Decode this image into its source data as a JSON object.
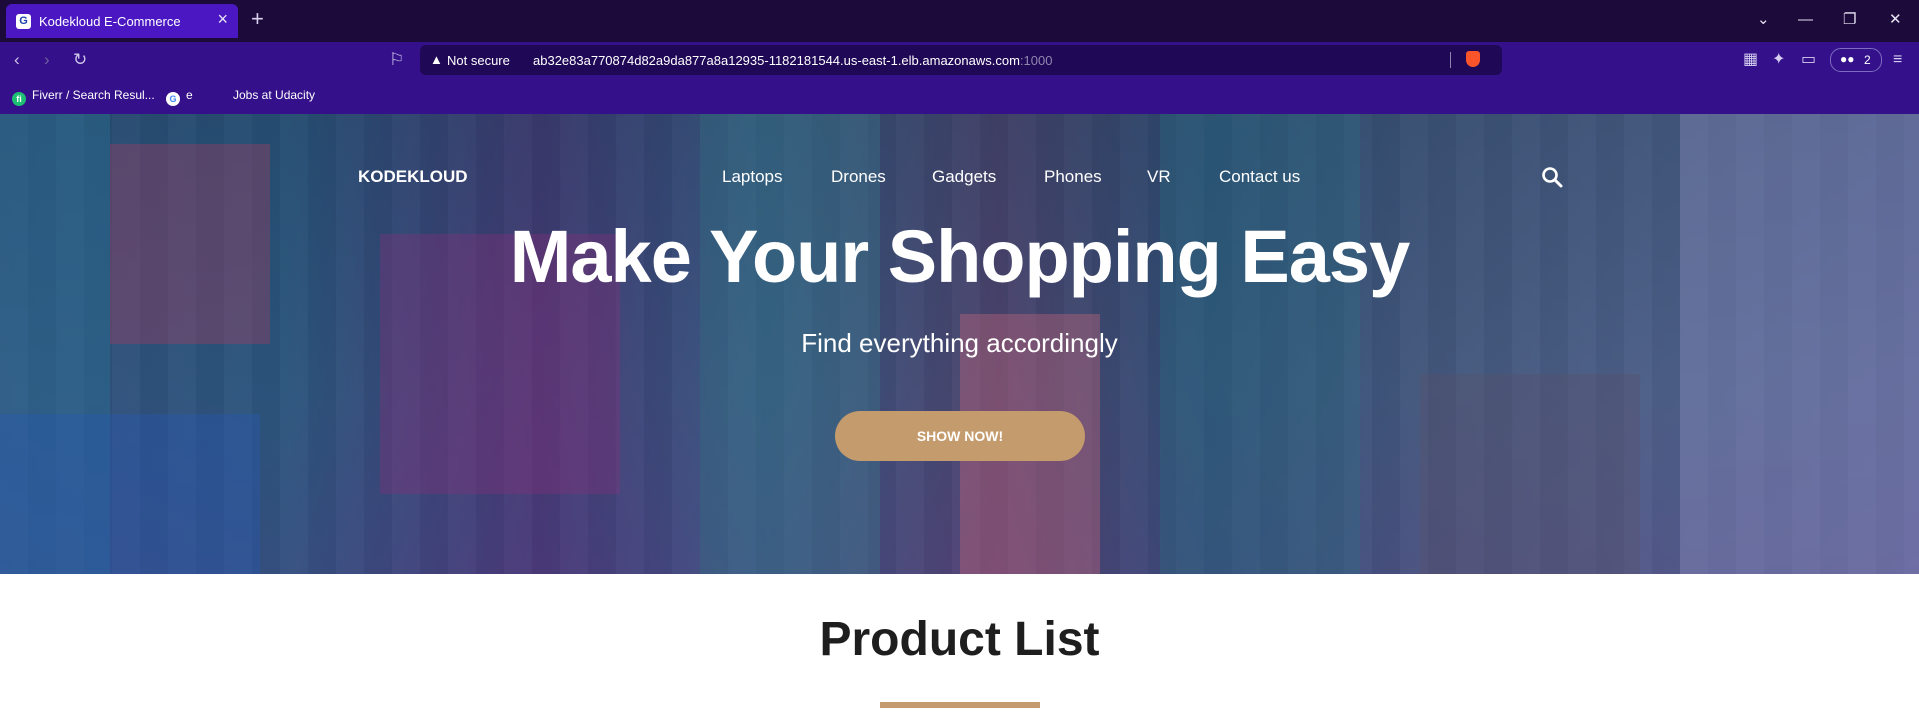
{
  "browser": {
    "tab_title": "Kodekloud E-Commerce",
    "tab_favicon": "G",
    "new_tab_icon": "+",
    "address": {
      "security_label": "Not secure",
      "url_main": "ab32e83a770874d82a9da877a8a12935-1182181544.us-east-1.elb.amazonaws.com",
      "url_port": ":1000"
    },
    "badge_count": "2",
    "bookmarks": [
      {
        "label": "Fiverr / Search Resul..."
      },
      {
        "label": "e"
      },
      {
        "label": "Jobs at Udacity"
      }
    ],
    "colors": {
      "tabbar": "#1c0a3a",
      "toolbar": "#34108a",
      "active_tab": "#4a17c2"
    }
  },
  "site": {
    "brand": "KODEKLOUD",
    "menu": [
      "Laptops",
      "Drones",
      "Gadgets",
      "Phones",
      "VR",
      "Contact us"
    ],
    "hero": {
      "headline": "Make Your Shopping Easy",
      "subline": "Find everything accordingly",
      "cta_label": "SHOW NOW!"
    },
    "section_title": "Product List",
    "accent_color": "#c49b6c"
  }
}
